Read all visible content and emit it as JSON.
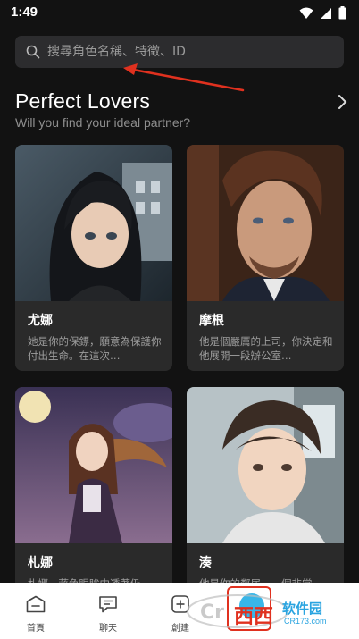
{
  "status_bar": {
    "time": "1:49"
  },
  "search": {
    "placeholder": "搜尋角色名稱、特徵、ID"
  },
  "section": {
    "title": "Perfect Lovers",
    "subtitle": "Will you find your ideal partner?"
  },
  "cards": [
    {
      "name": "尤娜",
      "desc": "她是你的保鏢，願意為保護你付出生命。在這次…"
    },
    {
      "name": "摩根",
      "desc": "他是個嚴厲的上司，你決定和他展開一段辦公室…"
    },
    {
      "name": "札娜",
      "desc": "札娜，蔣色眼眸中透著仍"
    },
    {
      "name": "湊",
      "desc": "他是你的鄰居，一個非常"
    }
  ],
  "bottom_nav": {
    "home_label": "首頁",
    "chat_label": "聊天",
    "create_label": "創建"
  },
  "watermark": {
    "logo": "西西",
    "brand": "软件园",
    "url": "CR173.com"
  },
  "colors": {
    "accent_red": "#e0311f",
    "accent_blue": "#38b6e8",
    "background": "#121212"
  }
}
